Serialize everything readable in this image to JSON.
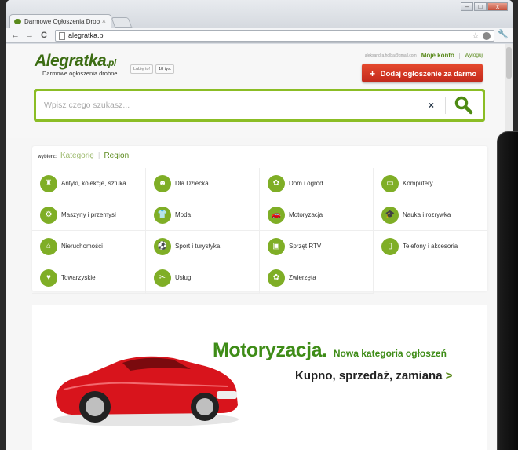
{
  "browser": {
    "tab_title": "Darmowe Ogłoszenia Drob",
    "url": "alegratka.pl",
    "nav_back": "←",
    "nav_forward": "→",
    "nav_reload": "C"
  },
  "header": {
    "logo_text": "Alegratka",
    "logo_suffix": ".pl",
    "logo_tagline": "Darmowe ogłoszenia drobne",
    "like_label": "Lubię to!",
    "like_count": "18 tys.",
    "user_email": "aleksandra.holba@gmail.com",
    "my_account": "Moje konto",
    "logout": "Wyloguj",
    "add_button": "Dodaj ogłoszenie za darmo",
    "add_plus": "+"
  },
  "search": {
    "placeholder": "Wpisz czego szukasz...",
    "clear": "×"
  },
  "categories": {
    "choose_label": "wybierz:",
    "tab_category": "Kategorię",
    "tab_region": "Region",
    "items": [
      {
        "label": "Antyki, kolekcje, sztuka",
        "icon": "antique-icon",
        "glyph": "♜"
      },
      {
        "label": "Dla Dziecka",
        "icon": "baby-icon",
        "glyph": "☻"
      },
      {
        "label": "Dom i ogród",
        "icon": "watering-can-icon",
        "glyph": "✿"
      },
      {
        "label": "Komputery",
        "icon": "monitor-icon",
        "glyph": "▭"
      },
      {
        "label": "Maszyny i przemysł",
        "icon": "tractor-icon",
        "glyph": "⚙"
      },
      {
        "label": "Moda",
        "icon": "tshirt-icon",
        "glyph": "👕"
      },
      {
        "label": "Motoryzacja",
        "icon": "car-icon",
        "glyph": "🚗"
      },
      {
        "label": "Nauka i rozrywka",
        "icon": "graduation-cap-icon",
        "glyph": "🎓"
      },
      {
        "label": "Nieruchomości",
        "icon": "house-icon",
        "glyph": "⌂"
      },
      {
        "label": "Sport i turystyka",
        "icon": "ball-icon",
        "glyph": "⚽"
      },
      {
        "label": "Sprzęt RTV",
        "icon": "tv-icon",
        "glyph": "▣"
      },
      {
        "label": "Telefony i akcesoria",
        "icon": "phone-icon",
        "glyph": "▯"
      },
      {
        "label": "Towarzyskie",
        "icon": "heart-icon",
        "glyph": "♥"
      },
      {
        "label": "Usługi",
        "icon": "tools-icon",
        "glyph": "✂"
      },
      {
        "label": "Zwierzęta",
        "icon": "paw-icon",
        "glyph": "✿"
      }
    ]
  },
  "banner": {
    "title": "Motoryzacja.",
    "subtitle_small": "Nowa kategoria ogłoszeń",
    "tagline": "Kupno, sprzedaż, zamiana",
    "arrow": ">"
  },
  "colors": {
    "brand_green": "#7fae26",
    "dark_green": "#3c6d13",
    "add_red": "#d5341f"
  }
}
